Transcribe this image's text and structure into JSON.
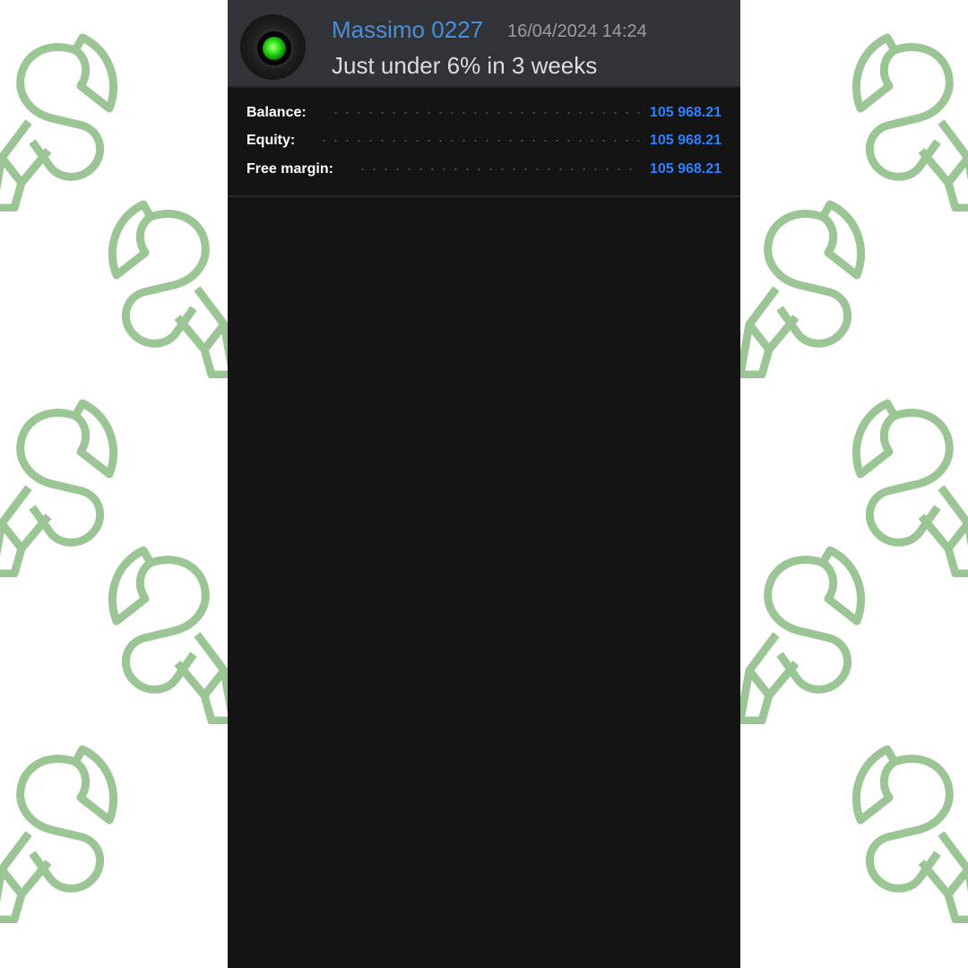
{
  "colors": {
    "background": "#ffffff",
    "logo_pattern": "#9cc596",
    "panel": "#141414",
    "header": "#313338",
    "username": "#4a8fd6",
    "value": "#2f80ff"
  },
  "chat": {
    "username": "Massimo 0227",
    "timestamp": "16/04/2024 14:24",
    "message": "Just under 6% in 3 weeks",
    "avatar_icon": "green-eye-avatar-icon"
  },
  "account": {
    "rows": [
      {
        "label": "Balance:",
        "value": "105 968.21"
      },
      {
        "label": "Equity:",
        "value": "105 968.21"
      },
      {
        "label": "Free margin:",
        "value": "105 968.21"
      }
    ]
  }
}
